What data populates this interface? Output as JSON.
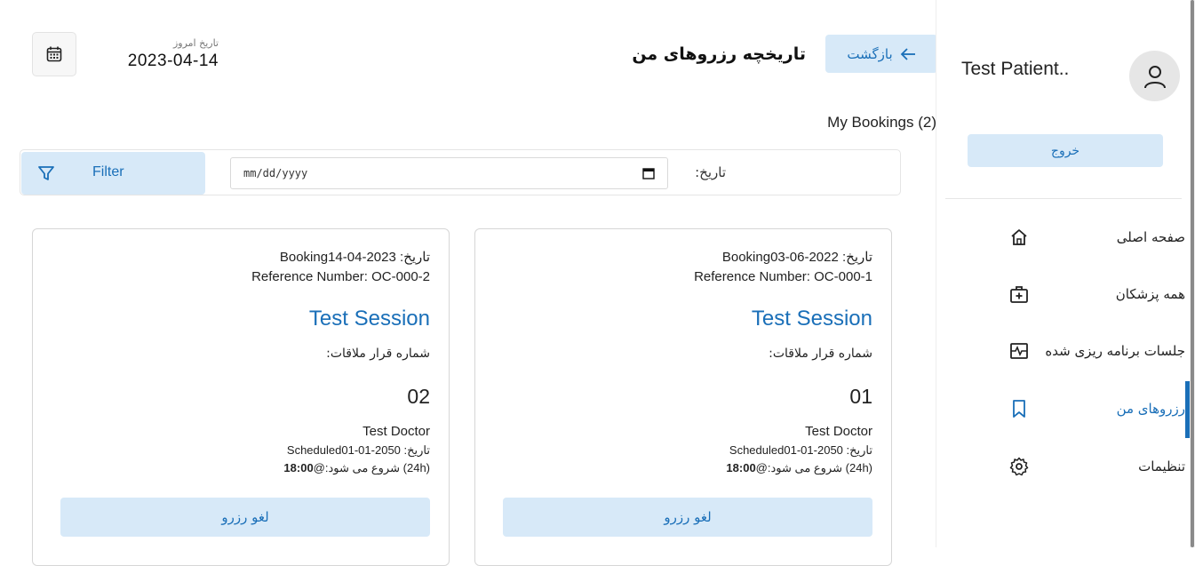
{
  "header": {
    "today_label": "تاریخ امروز",
    "today_date": "2023-04-14",
    "page_title": "تاریخچه رزروهای من",
    "back_label": "بازگشت",
    "calendar_icon": "calendar-icon"
  },
  "bookings_summary": "My Bookings (2)",
  "filter": {
    "button_label": "Filter",
    "date_label": "تاریخ:",
    "date_placeholder": "mm/dd/yyyy"
  },
  "cards": [
    {
      "booking_date": "Bookingتاریخ: 2023-04-14",
      "reference": "Reference Number: OC-000-2",
      "session": "Test Session",
      "appointment_label": "شماره قرار ملاقات:",
      "appointment_no": "02",
      "doctor": "Test Doctor",
      "scheduled": "Scheduledتاریخ: 2050-01-01",
      "starts_prefix": "شروع می شود:@",
      "starts_time": "18:00",
      "starts_suffix": " (24h)",
      "cancel_label": "لغو رزرو"
    },
    {
      "booking_date": "Bookingتاریخ: 2022-06-03",
      "reference": "Reference Number: OC-000-1",
      "session": "Test Session",
      "appointment_label": "شماره قرار ملاقات:",
      "appointment_no": "01",
      "doctor": "Test Doctor",
      "scheduled": "Scheduledتاریخ: 2050-01-01",
      "starts_prefix": "شروع می شود:@",
      "starts_time": "18:00",
      "starts_suffix": " (24h)",
      "cancel_label": "لغو رزرو"
    }
  ],
  "sidebar": {
    "patient_name": "Test Patient..",
    "logout_label": "خروج",
    "items": [
      {
        "label": "صفحه اصلی",
        "icon": "home-icon"
      },
      {
        "label": "همه پزشکان",
        "icon": "medical-bag-icon"
      },
      {
        "label": "جلسات برنامه ریزی شده",
        "icon": "schedule-icon"
      },
      {
        "label": "رزروهای من",
        "icon": "bookmark-icon",
        "active": true
      },
      {
        "label": "تنظیمات",
        "icon": "gear-icon"
      }
    ]
  },
  "colors": {
    "accent": "#1a6fb8",
    "button_bg": "#d7e9f8"
  }
}
